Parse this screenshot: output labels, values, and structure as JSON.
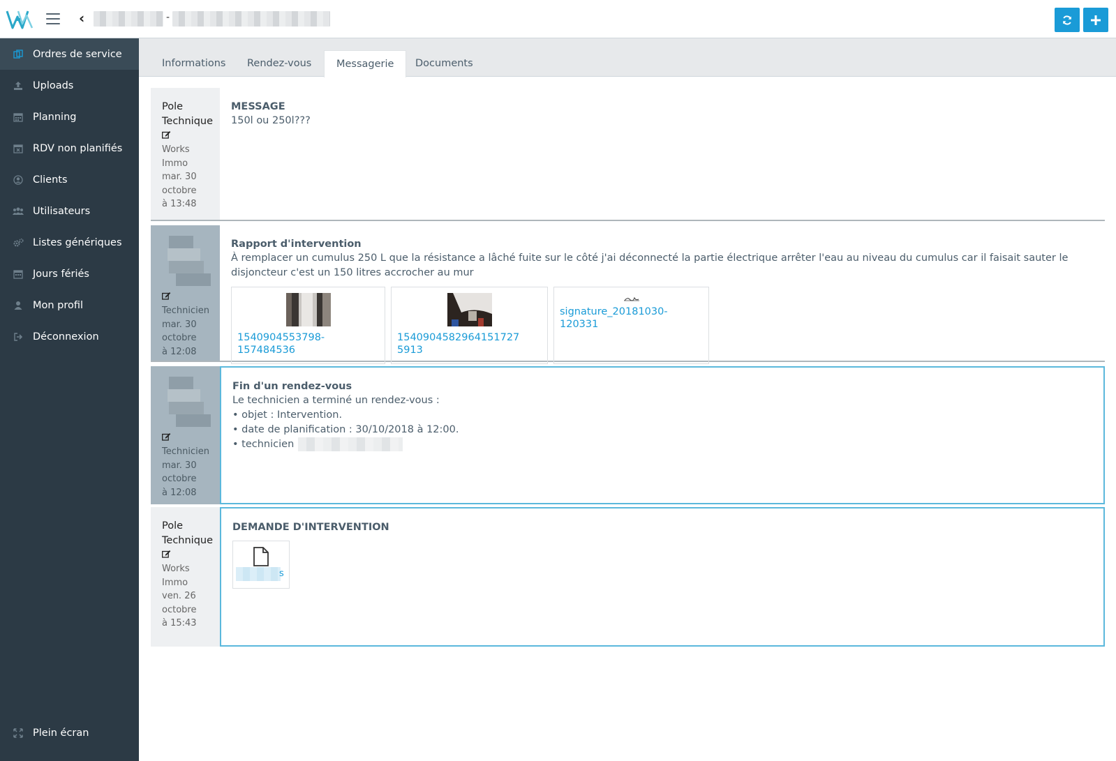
{
  "header": {
    "refresh_icon": "refresh-icon",
    "add_icon": "plus-icon"
  },
  "sidebar": {
    "items": [
      {
        "label": "Ordres de service",
        "icon": "service-orders-icon"
      },
      {
        "label": "Uploads",
        "icon": "upload-icon"
      },
      {
        "label": "Planning",
        "icon": "calendar-icon"
      },
      {
        "label": "RDV non planifiés",
        "icon": "calendar-x-icon"
      },
      {
        "label": "Clients",
        "icon": "user-circle-icon"
      },
      {
        "label": "Utilisateurs",
        "icon": "users-icon"
      },
      {
        "label": "Listes génériques",
        "icon": "cogs-icon"
      },
      {
        "label": "Jours fériés",
        "icon": "calendar-icon"
      },
      {
        "label": "Mon profil",
        "icon": "user-icon"
      },
      {
        "label": "Déconnexion",
        "icon": "sign-out-icon"
      }
    ],
    "fullscreen_label": "Plein écran"
  },
  "tabs": [
    {
      "label": "Informations"
    },
    {
      "label": "Rendez-vous"
    },
    {
      "label": "Messagerie"
    },
    {
      "label": "Documents"
    }
  ],
  "active_tab": "Messagerie",
  "messages": [
    {
      "author": "Pole Technique",
      "role_1": "Works",
      "role_2": "Immo",
      "date_1": "mar. 30",
      "date_2": "octobre",
      "date_3": "à 13:48",
      "title": "MESSAGE",
      "text": "150l ou 250l???"
    },
    {
      "role_1": "Technicien",
      "date_1": "mar. 30",
      "date_2": "octobre",
      "date_3": "à 12:08",
      "title": "Rapport d'intervention",
      "text_line_1": "À remplacer un cumulus 250 L que la résistance a lâché fuite sur le côté j'ai déconnecté la partie électrique arrêter l'eau au niveau du cumulus car il faisait sauter le",
      "text_line_2": "disjoncteur c'est un 150 litres accrocher au mur",
      "attachments": [
        {
          "name": "1540904553798-157484536"
        },
        {
          "name": "1540904582964151727 5913"
        },
        {
          "name": "signature_20181030-120331"
        }
      ]
    },
    {
      "role_1": "Technicien",
      "date_1": "mar. 30",
      "date_2": "octobre",
      "date_3": "à 12:08",
      "title": "Fin d'un rendez-vous",
      "line_1": "Le technicien a terminé un rendez-vous :",
      "line_2": "• objet : Intervention.",
      "line_3": "• date de planification : 30/10/2018 à 12:00.",
      "line_4": "• technicien"
    },
    {
      "author": "Pole Technique",
      "role_1": "Works",
      "role_2": "Immo",
      "date_1": "ven. 26",
      "date_2": "octobre",
      "date_3": "à 15:43",
      "title": "DEMANDE D'INTERVENTION",
      "doc_suffix": "s"
    }
  ],
  "colors": {
    "accent": "#1a9bd7",
    "sidebar_bg": "#2c3a45",
    "frame": "#5bb8dc"
  }
}
